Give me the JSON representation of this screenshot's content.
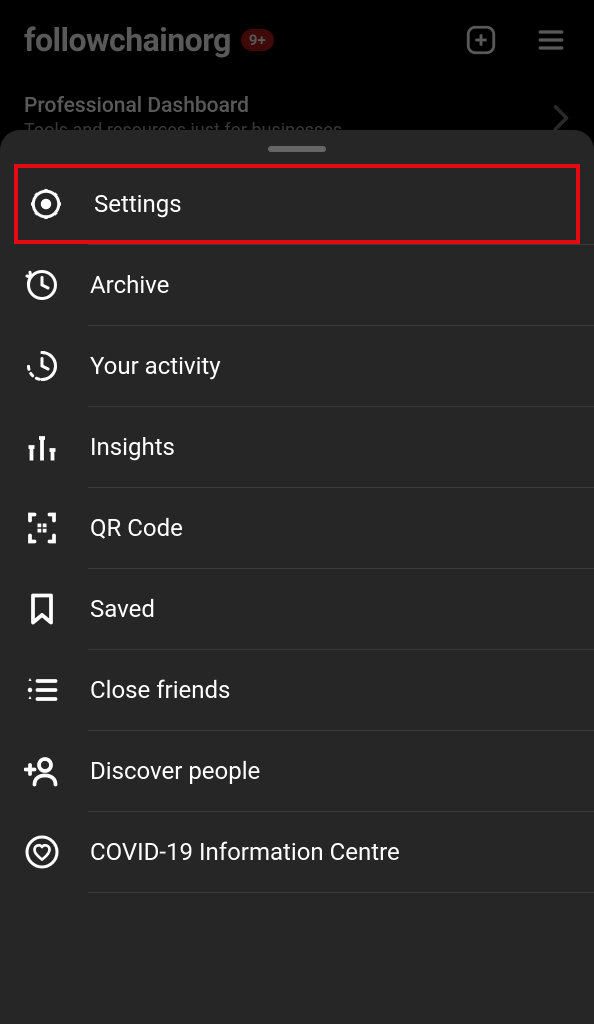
{
  "header": {
    "username": "followchainorg",
    "badge": "9+"
  },
  "dashboard": {
    "title": "Professional Dashboard",
    "subtitle": "Tools and resources just for businesses."
  },
  "menu": {
    "items": [
      {
        "label": "Settings",
        "icon": "gear-icon",
        "highlighted": true
      },
      {
        "label": "Archive",
        "icon": "archive-icon",
        "highlighted": false
      },
      {
        "label": "Your activity",
        "icon": "activity-icon",
        "highlighted": false
      },
      {
        "label": "Insights",
        "icon": "insights-icon",
        "highlighted": false
      },
      {
        "label": "QR Code",
        "icon": "qr-code-icon",
        "highlighted": false
      },
      {
        "label": "Saved",
        "icon": "bookmark-icon",
        "highlighted": false
      },
      {
        "label": "Close friends",
        "icon": "close-friends-icon",
        "highlighted": false
      },
      {
        "label": "Discover people",
        "icon": "discover-people-icon",
        "highlighted": false
      },
      {
        "label": "COVID-19 Information Centre",
        "icon": "heart-circle-icon",
        "highlighted": false
      }
    ]
  }
}
